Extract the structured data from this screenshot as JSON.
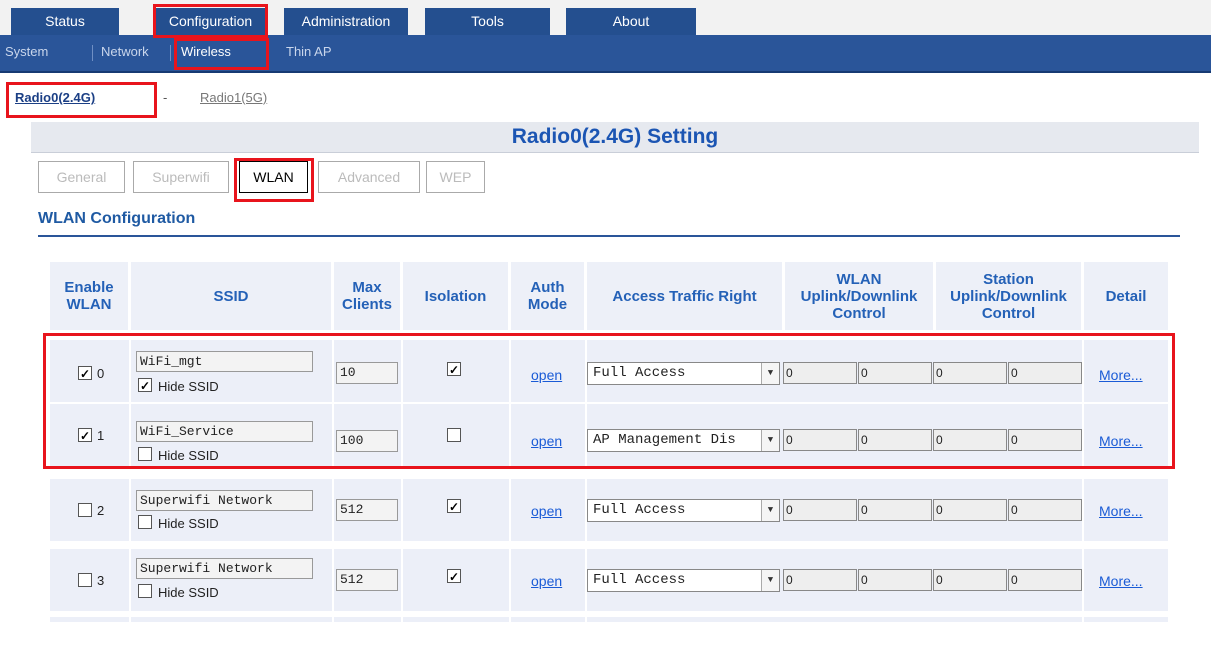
{
  "top_nav": {
    "tabs": [
      "Status",
      "Configuration",
      "Administration",
      "Tools",
      "About"
    ],
    "active": "Configuration"
  },
  "sub_nav": {
    "items": [
      "System",
      "Network",
      "Wireless",
      "Thin AP"
    ],
    "active": "Wireless"
  },
  "radio_links": [
    "Radio0(2.4G)",
    "-",
    "Radio1(5G)"
  ],
  "setting_title": "Radio0(2.4G) Setting",
  "subtabs": [
    "General",
    "Superwifi",
    "WLAN",
    "Advanced",
    "WEP"
  ],
  "active_subtab": "WLAN",
  "section_title": "WLAN Configuration",
  "table": {
    "headers": {
      "enable": "Enable WLAN",
      "ssid": "SSID",
      "max_clients": "Max Clients",
      "isolation": "Isolation",
      "auth_mode": "Auth Mode",
      "access": "Access Traffic Right",
      "wlan_ctrl": "WLAN Uplink/Downlink Control",
      "station_ctrl": "Station Uplink/Downlink Control",
      "detail": "Detail"
    },
    "hide_ssid_label": "Hide SSID",
    "rows": [
      {
        "index": "0",
        "enabled": true,
        "ssid": "WiFi_mgt",
        "hide_ssid": true,
        "max_clients": "10",
        "isolation": true,
        "auth": "open",
        "access": "Full Access",
        "wlan_up": "0",
        "wlan_down": "0",
        "sta_up": "0",
        "sta_down": "0",
        "detail": "More..."
      },
      {
        "index": "1",
        "enabled": true,
        "ssid": "WiFi_Service",
        "hide_ssid": false,
        "max_clients": "100",
        "isolation": false,
        "auth": "open",
        "access": "AP Management Dis",
        "wlan_up": "0",
        "wlan_down": "0",
        "sta_up": "0",
        "sta_down": "0",
        "detail": "More..."
      },
      {
        "index": "2",
        "enabled": false,
        "ssid": "Superwifi Network",
        "hide_ssid": false,
        "max_clients": "512",
        "isolation": true,
        "auth": "open",
        "access": "Full Access",
        "wlan_up": "0",
        "wlan_down": "0",
        "sta_up": "0",
        "sta_down": "0",
        "detail": "More..."
      },
      {
        "index": "3",
        "enabled": false,
        "ssid": "Superwifi Network",
        "hide_ssid": false,
        "max_clients": "512",
        "isolation": true,
        "auth": "open",
        "access": "Full Access",
        "wlan_up": "0",
        "wlan_down": "0",
        "sta_up": "0",
        "sta_down": "0",
        "detail": "More..."
      }
    ]
  },
  "colors": {
    "nav_blue": "#2a5599",
    "title_blue": "#1b55b3",
    "highlight_red": "#e8141c",
    "row_bg": "#eceff8"
  }
}
